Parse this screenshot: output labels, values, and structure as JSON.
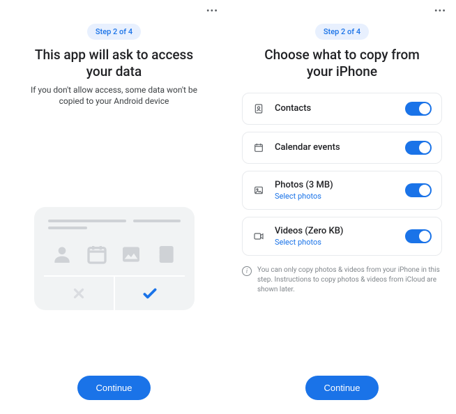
{
  "left": {
    "step": "Step 2 of 4",
    "title": "This app will ask to access your data",
    "subtitle": "If you don't allow access, some data won't be copied to your Android device",
    "continue": "Continue"
  },
  "right": {
    "step": "Step 2 of 4",
    "title": "Choose what to copy from your iPhone",
    "options": [
      {
        "icon": "contacts-icon",
        "label": "Contacts",
        "link": "",
        "on": true
      },
      {
        "icon": "calendar-icon",
        "label": "Calendar events",
        "link": "",
        "on": true
      },
      {
        "icon": "photos-icon",
        "label": "Photos (3 MB)",
        "link": "Select photos",
        "on": true
      },
      {
        "icon": "videos-icon",
        "label": "Videos (Zero KB)",
        "link": "Select photos",
        "on": true
      }
    ],
    "info": "You can only copy photos & videos from your iPhone in this step. Instructions to copy photos & videos from iCloud are shown later.",
    "continue": "Continue"
  }
}
